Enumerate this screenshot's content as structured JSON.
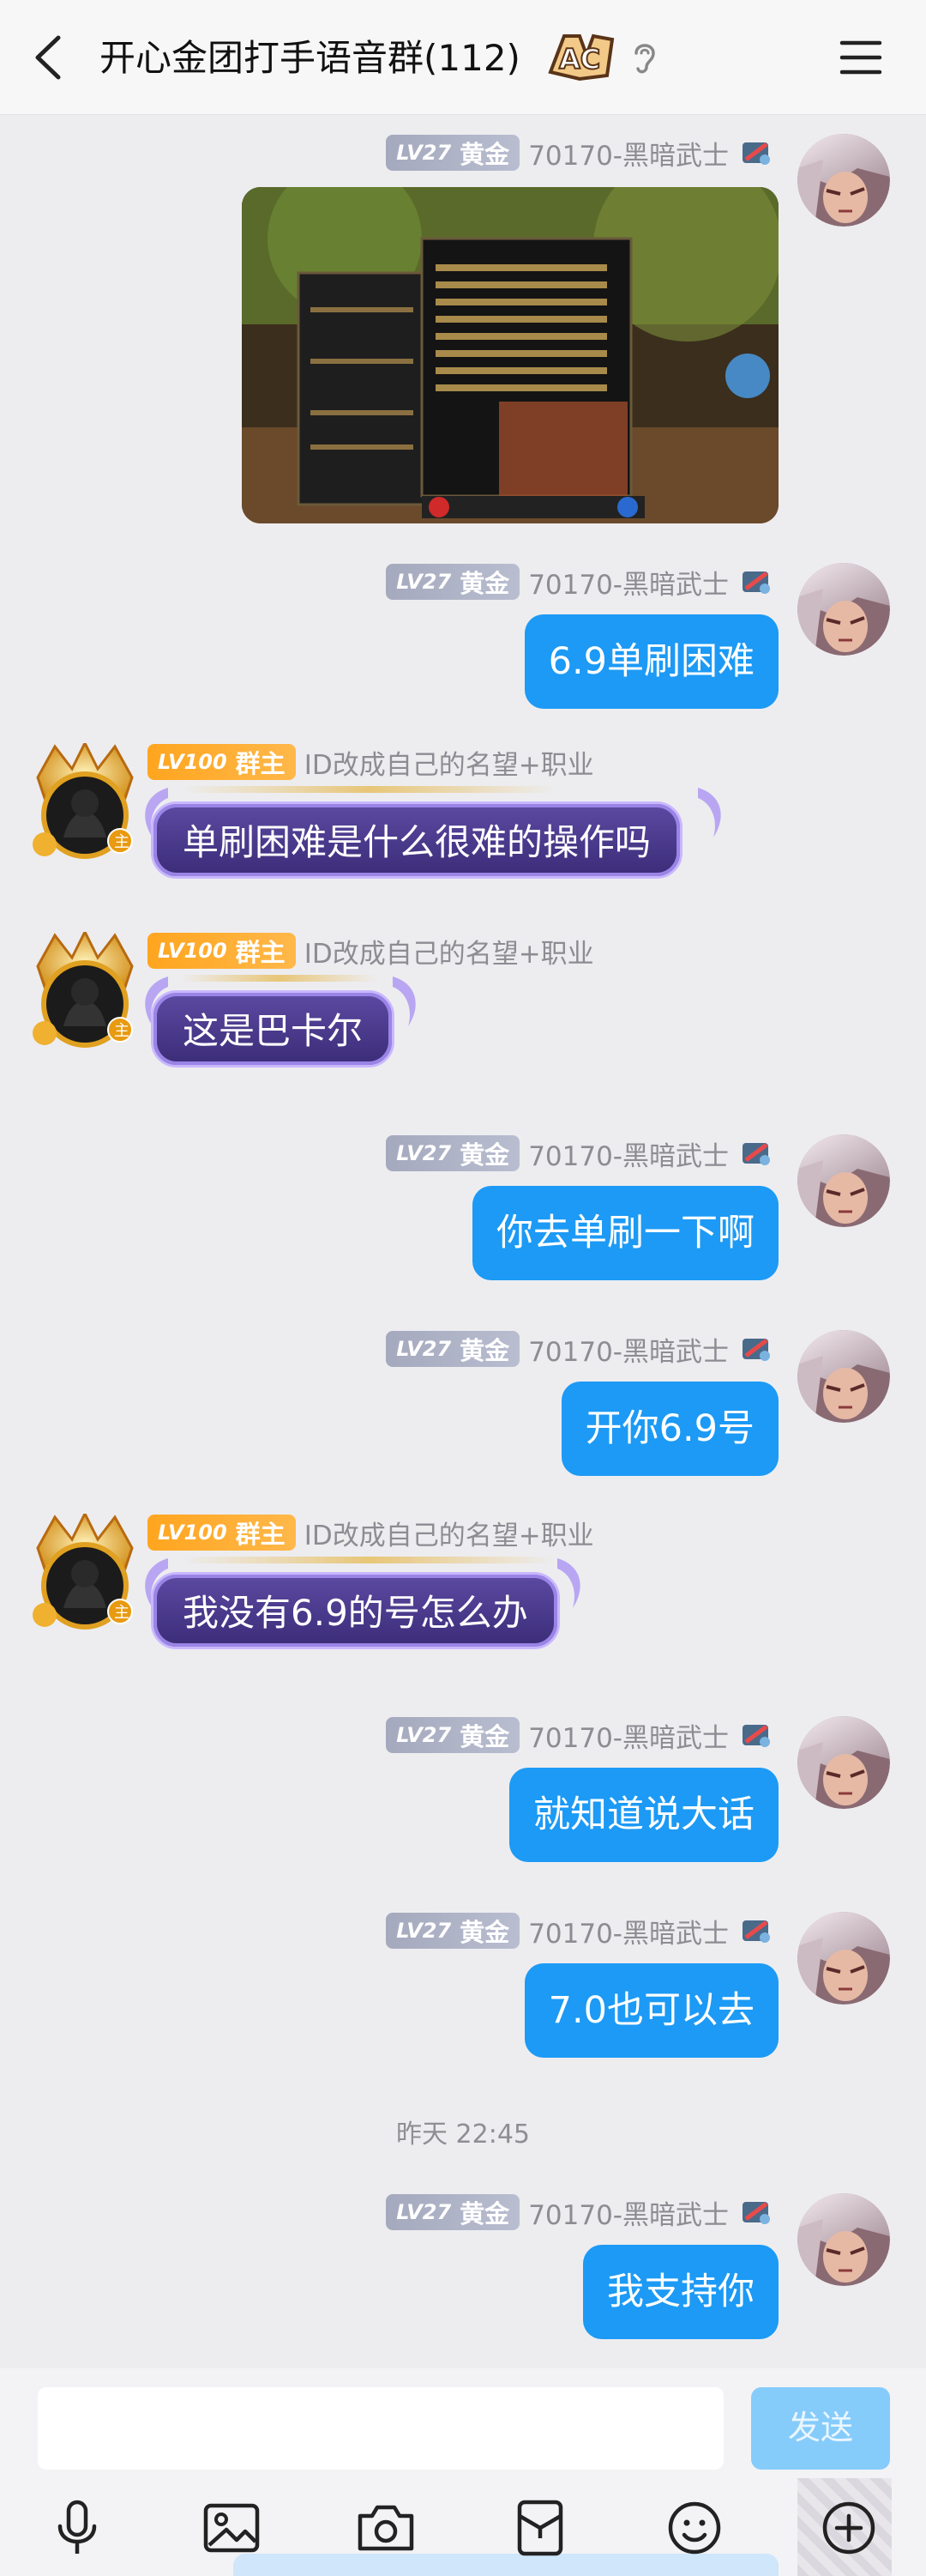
{
  "header": {
    "title": "开心金团打手语音群(112)",
    "badge_text": "AC"
  },
  "me": {
    "level": "LV27",
    "rank": "黄金",
    "nickname": "70170-黑暗武士"
  },
  "owner": {
    "level": "LV100",
    "rank": "群主",
    "nickname": "ID改成自己的名望+职业",
    "avatar_badge": "主"
  },
  "messages": [
    {
      "text": "6.9单刷困难"
    },
    {
      "text": "单刷困难是什么很难的操作吗"
    },
    {
      "text": "这是巴卡尔"
    },
    {
      "text": "你去单刷一下啊"
    },
    {
      "text": "开你6.9号"
    },
    {
      "text": "我没有6.9的号怎么办"
    },
    {
      "text": "就知道说大话"
    },
    {
      "text": "7.0也可以去"
    },
    {
      "text": "我支持你"
    }
  ],
  "timestamp": "昨天 22:45",
  "input": {
    "value": "",
    "placeholder": "",
    "send_label": "发送"
  },
  "colors": {
    "my_bubble": "#1c9af5",
    "owner_bubble": "#3b2c78",
    "send_disabled": "#86ccfb",
    "background": "#ededf0"
  },
  "icons": [
    "back-arrow-icon",
    "ear-icon",
    "menu-icon",
    "microphone-icon",
    "image-icon",
    "camera-icon",
    "red-packet-icon",
    "emoji-icon",
    "plus-icon"
  ]
}
